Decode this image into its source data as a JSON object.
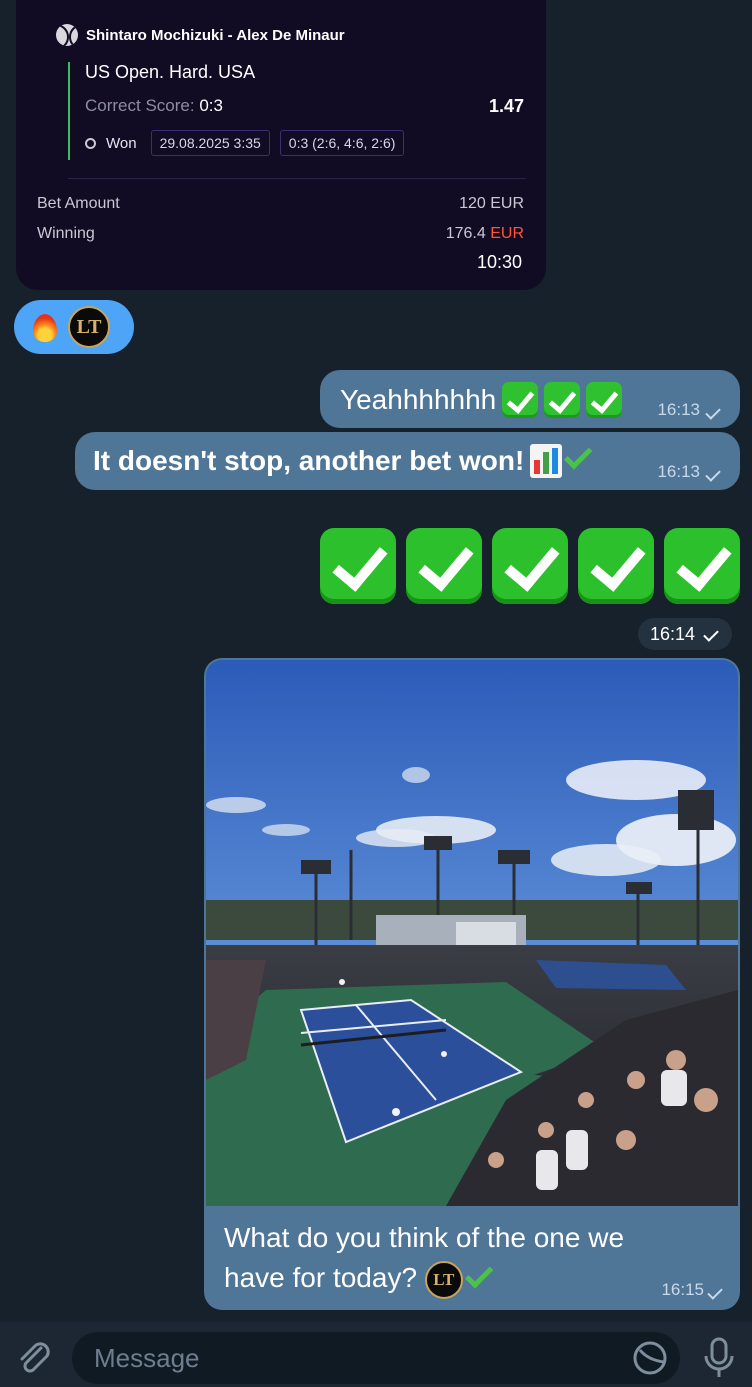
{
  "bet_card": {
    "match": "Shintaro Mochizuki - Alex De Minaur",
    "tournament": "US Open. Hard. USA",
    "market_label": "Correct Score:",
    "market_value": "0:3",
    "odds": "1.47",
    "status": "Won",
    "date": "29.08.2025 3:35",
    "score": "0:3 (2:6, 4:6, 2:6)",
    "bet_amount_label": "Bet Amount",
    "bet_amount_value": "120",
    "bet_amount_currency": "EUR",
    "winning_label": "Winning",
    "winning_value": "176.4",
    "winning_currency": "EUR",
    "time": "10:30"
  },
  "reactions": {
    "badge_text": "LT"
  },
  "messages": [
    {
      "text": "Yeahhhhhhh",
      "time": "16:13"
    },
    {
      "text": "It doesn't stop, another bet won!",
      "time": "16:13"
    }
  ],
  "checks_time": "16:14",
  "photo_message": {
    "caption": "What do you think of the one we have for today?",
    "badge_text": "LT",
    "time": "16:15"
  },
  "input": {
    "placeholder": "Message"
  },
  "colors": {
    "background": "#17212b",
    "bubble": "#4f7597",
    "card": "#120b24",
    "reaction": "#4ea4f6",
    "check_green": "#2cc12c"
  }
}
